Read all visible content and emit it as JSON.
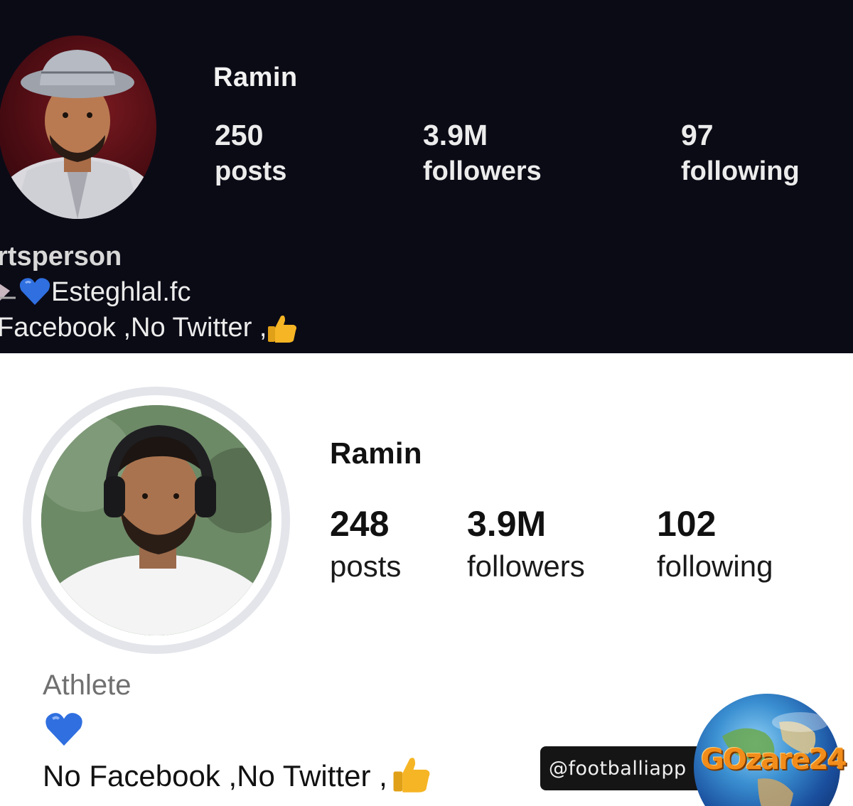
{
  "old_profile": {
    "theme": "dark",
    "background": "#0b0b16",
    "username": "Ramin",
    "stats": {
      "posts": {
        "value": "250",
        "label": "posts"
      },
      "followers": {
        "value": "3.9M",
        "label": "followers"
      },
      "following": {
        "value": "97",
        "label": "following"
      }
    },
    "bio": {
      "category": "rtsperson",
      "line1_text": "Esteghlal.fc",
      "line2_text": "Facebook ,No Twitter ,"
    },
    "icons": [
      "profile-photo",
      "blue-heart-icon",
      "thumbs-up-icon"
    ]
  },
  "new_profile": {
    "theme": "light",
    "background": "#ffffff",
    "username": "Ramin",
    "stats": {
      "posts": {
        "value": "248",
        "label": "posts"
      },
      "followers": {
        "value": "3.9M",
        "label": "followers"
      },
      "following": {
        "value": "102",
        "label": "following"
      }
    },
    "bio": {
      "category": "Athlete",
      "line2_text": "No Facebook ,No Twitter ,"
    },
    "icons": [
      "profile-photo",
      "blue-heart-icon",
      "thumbs-up-icon"
    ]
  },
  "watermarks": {
    "handle": "@footballiapp",
    "logo_text": "GOzare24"
  },
  "colors": {
    "dark_bg": "#0b0b16",
    "heart_blue": "#2f6fe0",
    "thumb_yellow": "#f6b524",
    "logo_orange": "#f28c1a"
  }
}
